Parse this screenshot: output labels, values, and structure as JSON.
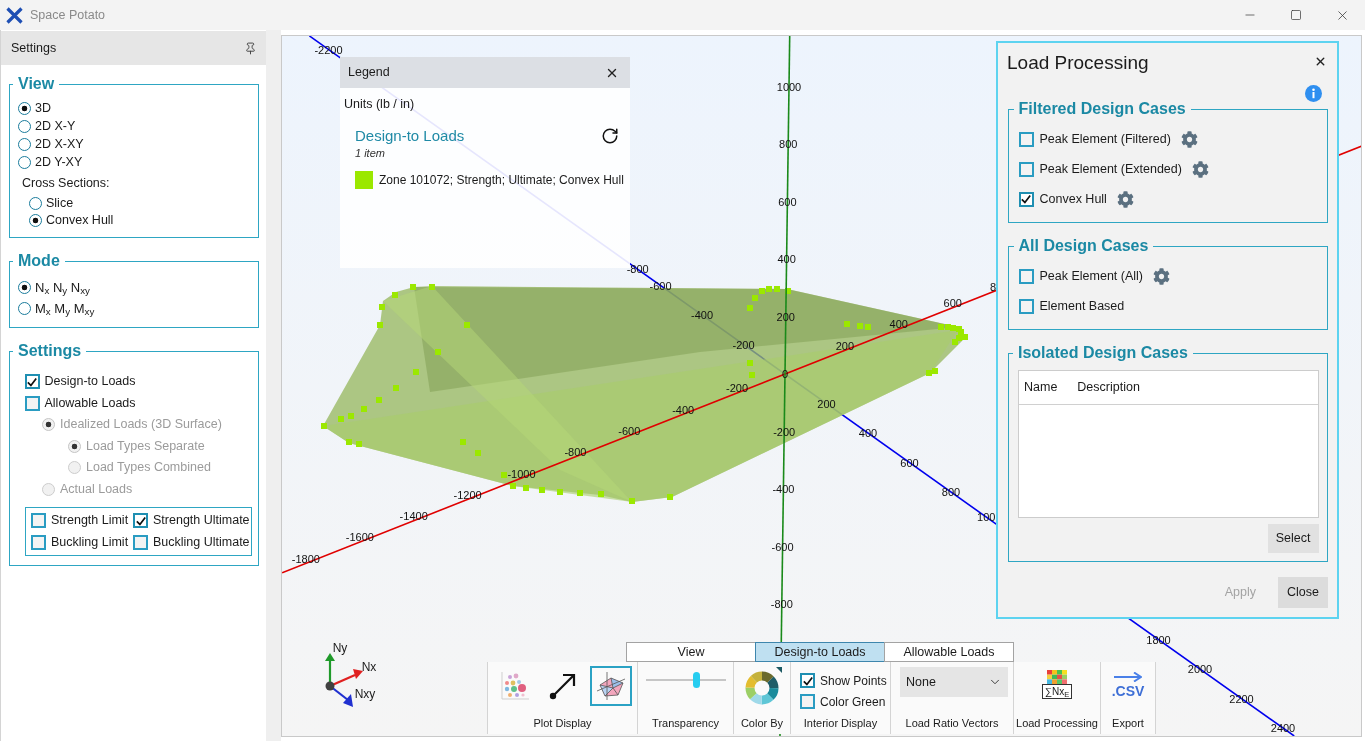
{
  "window": {
    "title": "Space Potato"
  },
  "settings_panel": {
    "title": "Settings",
    "view": {
      "title": "View",
      "options": [
        {
          "label": "3D",
          "selected": true
        },
        {
          "label": "2D X-Y",
          "selected": false
        },
        {
          "label": "2D X-XY",
          "selected": false
        },
        {
          "label": "2D Y-XY",
          "selected": false
        }
      ],
      "cross_sections": {
        "label": "Cross Sections:",
        "options": [
          {
            "label": "Slice",
            "selected": false
          },
          {
            "label": "Convex Hull",
            "selected": true
          }
        ]
      }
    },
    "mode": {
      "title": "Mode",
      "options": [
        {
          "label": "N$_{x}$ N$_{y}$ N$_{xy}$",
          "selected": true
        },
        {
          "label": "M$_{x}$ M$_{y}$ M$_{xy}$",
          "selected": false
        }
      ]
    },
    "settings": {
      "title": "Settings",
      "items": [
        {
          "kind": "checkbox",
          "label": "Design-to Loads",
          "checked": true,
          "disabled": false
        },
        {
          "kind": "checkbox",
          "label": "Allowable Loads",
          "checked": false,
          "disabled": false
        },
        {
          "kind": "radio",
          "label": "Idealized Loads (3D Surface)",
          "selected": true,
          "disabled": true,
          "children": [
            {
              "kind": "radio",
              "label": "Load Types Separate",
              "selected": true,
              "disabled": true
            },
            {
              "kind": "radio",
              "label": "Load Types Combined",
              "selected": false,
              "disabled": true
            }
          ]
        },
        {
          "kind": "radio",
          "label": "Actual Loads",
          "selected": false,
          "disabled": true
        }
      ],
      "limit_types": [
        {
          "label": "Strength Limit",
          "checked": false
        },
        {
          "label": "Strength Ultimate",
          "checked": true
        },
        {
          "label": "Buckling Limit",
          "checked": false
        },
        {
          "label": "Buckling Ultimate",
          "checked": false
        }
      ]
    }
  },
  "viewport": {
    "axes": [
      {
        "color": "#e00000",
        "ticks": [
          "-1800",
          "-1600",
          "-1400",
          "-1200",
          "-1000",
          "-800",
          "-600",
          "-400",
          "-200",
          "200",
          "400",
          "600",
          "8"
        ]
      },
      {
        "color": "#1a8a1a",
        "ticks": [
          "1000",
          "800",
          "600",
          "400",
          "200",
          "0",
          "-200",
          "-400",
          "-600",
          "-800"
        ]
      },
      {
        "color": "#0000ee",
        "ticks": [
          "-2200",
          "-800",
          "-600",
          "-400",
          "-200",
          "200",
          "400",
          "600",
          "800",
          "100",
          "1800",
          "2000",
          "2200",
          "2400"
        ]
      }
    ],
    "triad_labels": [
      "Ny",
      "Nx",
      "Nxy"
    ]
  },
  "legend": {
    "title": "Legend",
    "units": "Units (lb / in)",
    "section": {
      "title": "Design-to Loads",
      "count": "1 item",
      "items": [
        {
          "label": "Zone 101072; Strength; Ultimate; Convex Hull",
          "color": "#9be800"
        }
      ]
    }
  },
  "load_processing": {
    "title": "Load Processing",
    "groups": [
      {
        "title": "Filtered Design Cases",
        "items": [
          {
            "kind": "with_settings",
            "label": "Peak Element (Filtered)",
            "checked": false
          },
          {
            "kind": "with_settings",
            "label": "Peak Element (Extended)",
            "checked": false
          },
          {
            "kind": "with_settings",
            "label": "Convex Hull",
            "checked": true
          }
        ]
      },
      {
        "title": "All Design Cases",
        "items": [
          {
            "kind": "with_settings",
            "label": "Peak Element (All)",
            "checked": false
          },
          {
            "kind": "plain",
            "label": "Element Based",
            "checked": false
          }
        ]
      }
    ],
    "isolated": {
      "title": "Isolated Design Cases",
      "columns": [
        "Name",
        "Description"
      ],
      "button": "Select"
    },
    "buttons": [
      {
        "label": "Apply",
        "disabled": true
      },
      {
        "label": "Close",
        "disabled": false
      }
    ]
  },
  "toolbar": {
    "tabs": [
      {
        "label": "View",
        "selected": false
      },
      {
        "label": "Design-to Loads",
        "selected": true
      },
      {
        "label": "Allowable Loads",
        "selected": false
      }
    ],
    "groups": [
      {
        "kind": "plot_display",
        "label": "Plot Display",
        "buttons": [
          {
            "kind": "points",
            "selected": false
          },
          {
            "kind": "vectors",
            "selected": false
          },
          {
            "kind": "hull",
            "selected": true
          }
        ]
      },
      {
        "kind": "slider",
        "label": "Transparency",
        "level": 0.65
      },
      {
        "kind": "color_by",
        "label": "Color By"
      },
      {
        "kind": "checks",
        "label": "Interior Display",
        "items": [
          {
            "label": "Show Points",
            "checked": true
          },
          {
            "label": "Color Green",
            "checked": false
          }
        ]
      },
      {
        "kind": "dropdown",
        "label": "Load Ratio Vectors",
        "value": "None"
      },
      {
        "kind": "load_processing",
        "label": "Load Processing",
        "icon_text": "∑Nx$_{E}$"
      },
      {
        "kind": "export",
        "label": "Export",
        "icon_text": ".CSV"
      }
    ]
  }
}
